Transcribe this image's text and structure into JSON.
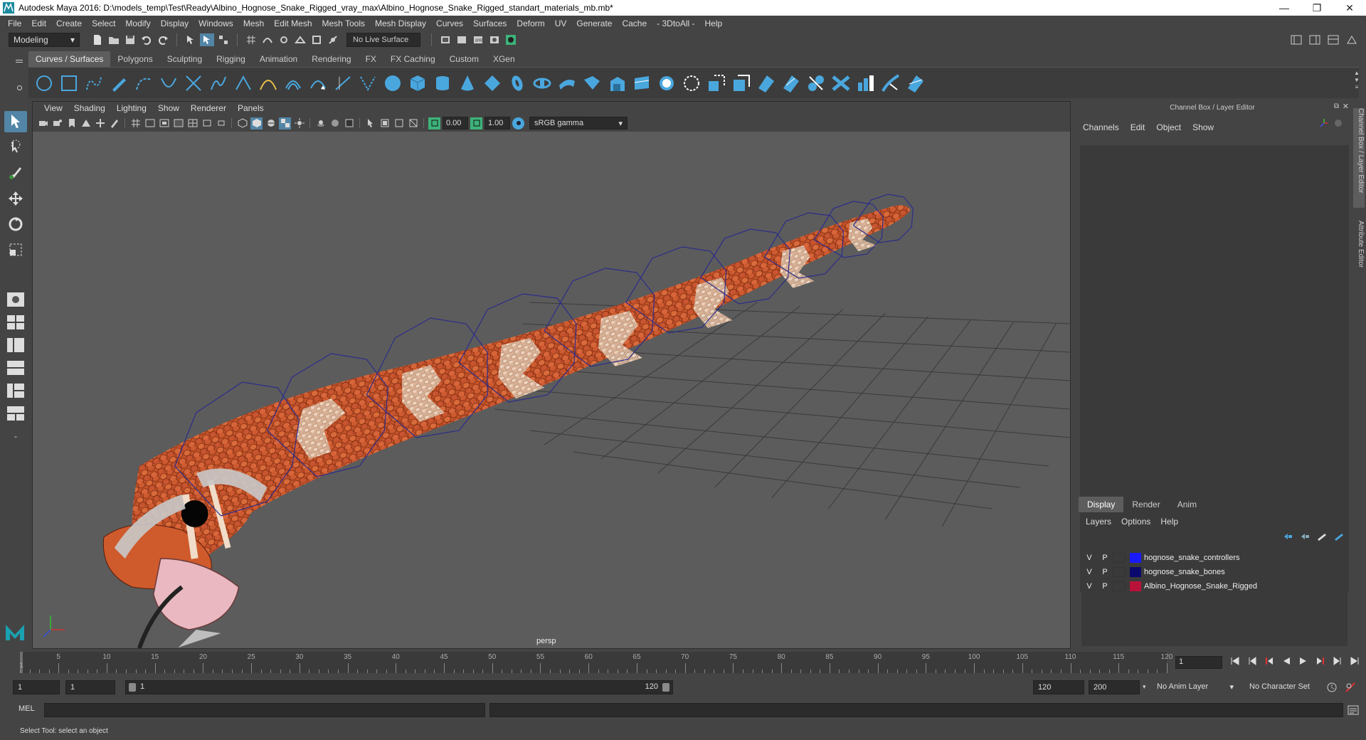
{
  "window": {
    "title": "Autodesk Maya 2016: D:\\models_temp\\Test\\Ready\\Albino_Hognose_Snake_Rigged_vray_max\\Albino_Hognose_Snake_Rigged_standart_materials_mb.mb*",
    "minimize": "—",
    "maximize": "❐",
    "close": "✕"
  },
  "menu": [
    "File",
    "Edit",
    "Create",
    "Select",
    "Modify",
    "Display",
    "Windows",
    "Mesh",
    "Edit Mesh",
    "Mesh Tools",
    "Mesh Display",
    "Curves",
    "Surfaces",
    "Deform",
    "UV",
    "Generate",
    "Cache",
    "- 3DtoAll -",
    "Help"
  ],
  "status": {
    "mode": "Modeling",
    "live_surface": "No Live Surface"
  },
  "shelf": {
    "tabs": [
      "Curves / Surfaces",
      "Polygons",
      "Sculpting",
      "Rigging",
      "Animation",
      "Rendering",
      "FX",
      "FX Caching",
      "Custom",
      "XGen"
    ],
    "active_tab": 0
  },
  "panel": {
    "menu": [
      "View",
      "Shading",
      "Lighting",
      "Show",
      "Renderer",
      "Panels"
    ],
    "exposure": "0.00",
    "gamma_value": "1.00",
    "colorspace": "sRGB gamma",
    "camera_label": "persp"
  },
  "channel_box": {
    "title": "Channel Box / Layer Editor",
    "menu": [
      "Channels",
      "Edit",
      "Object",
      "Show"
    ],
    "side_tabs": [
      "Channel Box / Layer Editor",
      "Attribute Editor"
    ]
  },
  "layer_editor": {
    "tabs": [
      "Display",
      "Render",
      "Anim"
    ],
    "menu": [
      "Layers",
      "Options",
      "Help"
    ],
    "layers": [
      {
        "v": "V",
        "p": "P",
        "name": "hognose_snake_controllers",
        "color": "#1a1aff"
      },
      {
        "v": "V",
        "p": "P",
        "name": "hognose_snake_bones",
        "color": "#0a0a6e"
      },
      {
        "v": "V",
        "p": "P",
        "name": "Albino_Hognose_Snake_Rigged",
        "color": "#b8123a"
      }
    ]
  },
  "timeline": {
    "start": 1,
    "end": 120,
    "ticks": [
      "5",
      "10",
      "15",
      "20",
      "25",
      "30",
      "35",
      "40",
      "45",
      "50",
      "55",
      "60",
      "65",
      "70",
      "75",
      "80",
      "85",
      "90",
      "95",
      "100",
      "105",
      "110",
      "115",
      "120"
    ],
    "first_label": "1",
    "current_frame": "1"
  },
  "range": {
    "anim_start": "1",
    "playback_start": "1",
    "slider_start": "1",
    "slider_end": "120",
    "playback_end": "120",
    "anim_end": "200",
    "anim_layer": "No Anim Layer",
    "character_set": "No Character Set"
  },
  "command": {
    "mel_label": "MEL"
  },
  "help": {
    "text": "Select Tool: select an object"
  },
  "colors": {
    "accent": "#5285a6",
    "shelf_icon": "#4aa7de",
    "snake_body": "#c85a2a",
    "controller_wire": "#2c2c8a"
  }
}
